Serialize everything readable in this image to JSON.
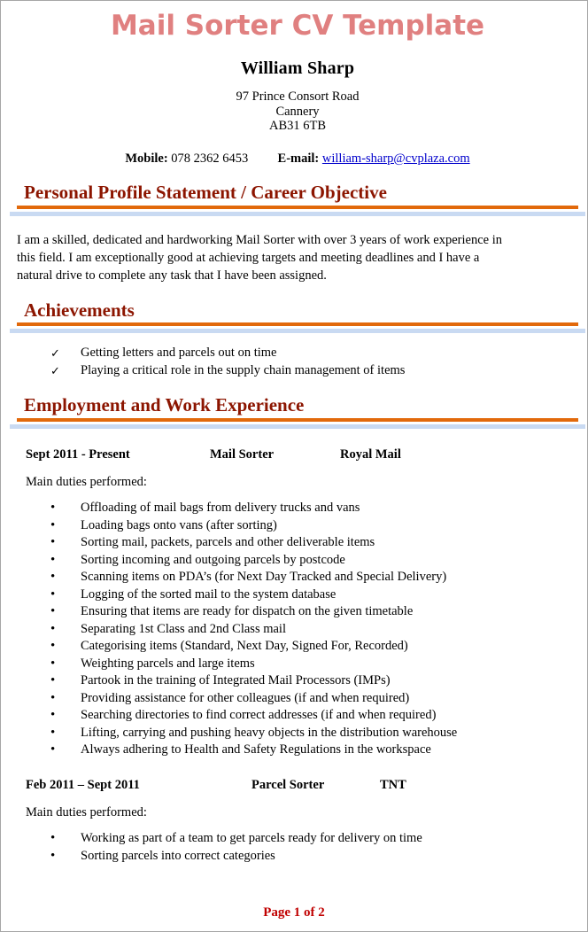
{
  "document": {
    "title": "Mail Sorter CV Template",
    "page_footer": "Page 1 of 2"
  },
  "colors": {
    "title": "#E08080",
    "section_heading": "#8C1500",
    "rule_orange": "#E2690B",
    "rule_blue": "#C9DAF2",
    "link": "#0000CC",
    "footer": "#C00000"
  },
  "personal": {
    "name": "William  Sharp",
    "address_line1": "97 Prince Consort Road",
    "address_line2": "Cannery",
    "address_line3": "AB31 6TB",
    "mobile_label": "Mobile:",
    "mobile_value": "078 2362 6453",
    "email_label": "E-mail:",
    "email_value": "william-sharp@cvplaza.com"
  },
  "sections": {
    "profile": {
      "heading": "Personal Profile Statement / Career Objective",
      "text": "I am a skilled, dedicated and hardworking Mail Sorter with over 3 years of work experience in this field. I am exceptionally good at achieving targets and meeting deadlines and I have a natural drive to complete any task that I have been assigned."
    },
    "achievements": {
      "heading": "Achievements",
      "marker": "✓",
      "items": [
        "Getting letters and parcels out on time",
        "Playing a critical role in the supply chain management of items"
      ]
    },
    "employment": {
      "heading": "Employment and Work Experience",
      "marker": "•",
      "duties_label": "Main duties performed:",
      "jobs": [
        {
          "date": "Sept 2011 - Present",
          "job_title": "Mail Sorter",
          "employer": "Royal Mail",
          "duties_label": "Main duties performed:",
          "duties": [
            "Offloading of mail bags from delivery trucks and vans",
            "Loading bags onto vans (after sorting)",
            "Sorting mail, packets, parcels and other deliverable items",
            "Sorting incoming and outgoing parcels by postcode",
            "Scanning items on PDA’s (for Next Day Tracked and Special Delivery)",
            "Logging of the sorted mail to the system database",
            "Ensuring that items are ready for dispatch on the given timetable",
            "Separating 1st Class and 2nd Class mail",
            "Categorising items (Standard, Next Day, Signed For, Recorded)",
            "Weighting parcels and large items",
            "Partook in the training of Integrated Mail Processors (IMPs)",
            "Providing assistance for other colleagues (if and when required)",
            "Searching directories to find correct addresses (if and when required)",
            "Lifting, carrying and pushing heavy objects in the distribution warehouse",
            "Always adhering to Health and Safety Regulations in the workspace"
          ]
        },
        {
          "date": "Feb 2011 – Sept 2011",
          "job_title": "Parcel Sorter",
          "employer": "TNT",
          "duties_label": "Main duties performed:",
          "duties": [
            "Working as part of a team to get parcels ready for delivery on time",
            "Sorting parcels into correct categories"
          ]
        }
      ]
    }
  }
}
